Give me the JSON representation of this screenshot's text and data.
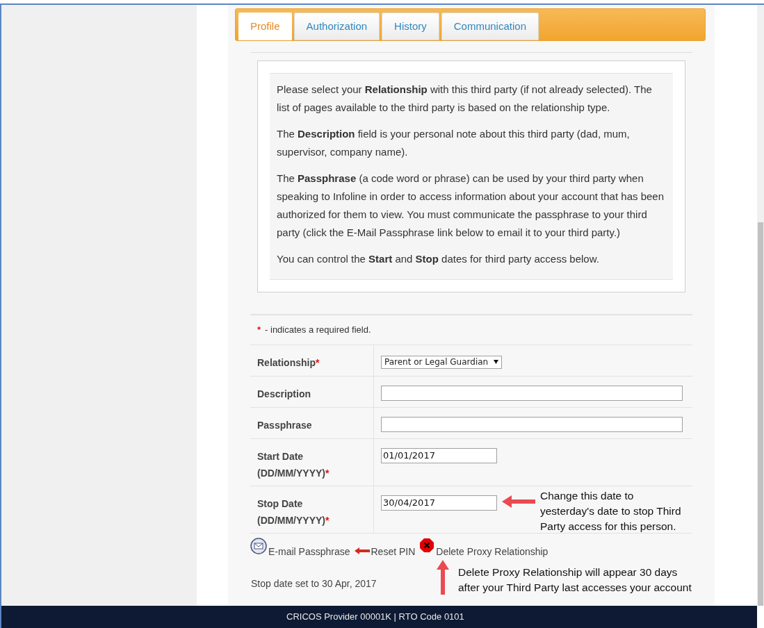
{
  "tabs": [
    {
      "label": "Profile",
      "selected": true
    },
    {
      "label": "Authorization",
      "selected": false
    },
    {
      "label": "History",
      "selected": false
    },
    {
      "label": "Communication",
      "selected": false
    }
  ],
  "info_paragraphs": [
    "Please select your **Relationship** with this third party (if not already selected). The list of pages available to the third party is based on the relationship type.",
    "The **Description** field is your personal note about this third party (dad, mum, supervisor, company name).",
    "The **Passphrase** (a code word or phrase) can be used by your third party when speaking to Infoline in order to access information about your account that has been authorized for them to view. You must communicate the passphrase to your third party (click the E-Mail Passphrase link below to email it to your third party.)",
    "You can control the **Start** and **Stop** dates for third party access below."
  ],
  "required_note": {
    "mark": "*",
    "text": "- indicates a required field."
  },
  "form_rows": [
    {
      "label": "Relationship",
      "required": true,
      "kind": "select",
      "value": "Parent or Legal Guardian"
    },
    {
      "label": "Description",
      "required": false,
      "kind": "text",
      "value": ""
    },
    {
      "label": "Passphrase",
      "required": false,
      "kind": "text",
      "value": ""
    },
    {
      "label": "Start Date",
      "hint": "(DD/MM/YYYY)",
      "required": true,
      "kind": "date",
      "value": "01/01/2017"
    },
    {
      "label": "Stop Date",
      "hint": "(DD/MM/YYYY)",
      "required": true,
      "kind": "date",
      "value": "30/04/2017"
    }
  ],
  "actions": [
    {
      "kind": "email",
      "label": "E-mail Passphrase"
    },
    {
      "kind": "reset",
      "label": "Reset PIN"
    },
    {
      "kind": "delete",
      "label": "Delete Proxy Relationship"
    }
  ],
  "status_message": "Stop date set to 30 Apr, 2017",
  "annotations": [
    {
      "kind": "arrow_left",
      "lines": [
        "Change this date to",
        "yesterday's date to stop Third",
        "Party access for this person."
      ]
    },
    {
      "kind": "arrow_up",
      "lines": [
        "Delete Proxy Relationship will appear 30 days",
        "after your Third Party last accesses your account"
      ]
    }
  ],
  "footer": "CRICOS Provider 00001K | RTO Code 0101"
}
